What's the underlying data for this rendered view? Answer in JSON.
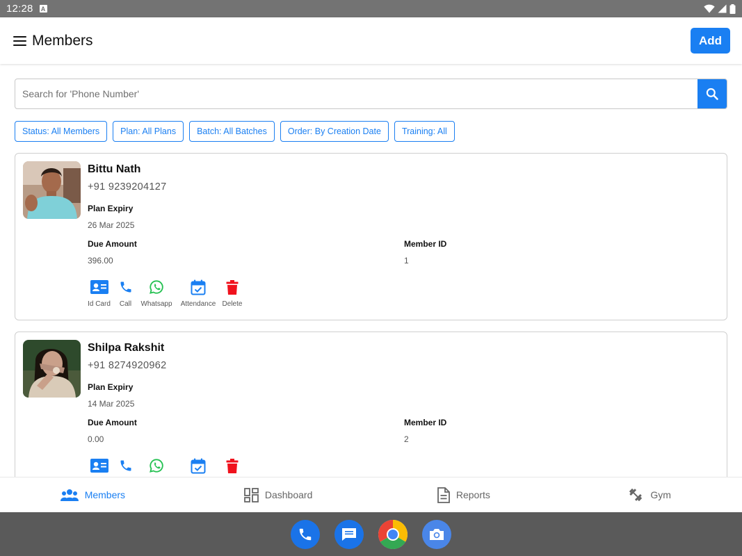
{
  "status_bar": {
    "time": "12:28",
    "notification_glyph": "A"
  },
  "app_bar": {
    "title": "Members",
    "add_label": "Add"
  },
  "search": {
    "placeholder": "Search for 'Phone Number'",
    "value": ""
  },
  "filters": [
    {
      "label": "Status: All Members"
    },
    {
      "label": "Plan: All Plans"
    },
    {
      "label": "Batch: All Batches"
    },
    {
      "label": "Order: By Creation Date"
    },
    {
      "label": "Training: All"
    }
  ],
  "labels": {
    "plan_expiry": "Plan Expiry",
    "due_amount": "Due Amount",
    "member_id": "Member ID"
  },
  "actions": [
    {
      "label": "Id Card",
      "icon": "id-card-icon",
      "color": "#1a7ff2"
    },
    {
      "label": "Call",
      "icon": "phone-icon",
      "color": "#1a7ff2"
    },
    {
      "label": "Whatsapp",
      "icon": "whatsapp-icon",
      "color": "#25c152"
    },
    {
      "label": "Attendance",
      "icon": "calendar-check-icon",
      "color": "#1a7ff2"
    },
    {
      "label": "Delete",
      "icon": "trash-icon",
      "color": "#f0121d"
    }
  ],
  "members": [
    {
      "name": "Bittu Nath",
      "phone": "+91 9239204127",
      "plan_expiry": "26 Mar 2025",
      "due_amount": "396.00",
      "member_id": "1"
    },
    {
      "name": "Shilpa Rakshit",
      "phone": "+91 8274920962",
      "plan_expiry": "14 Mar 2025",
      "due_amount": "0.00",
      "member_id": "2"
    }
  ],
  "bottom_nav": [
    {
      "label": "Members",
      "icon": "members-icon",
      "active": true
    },
    {
      "label": "Dashboard",
      "icon": "dashboard-icon",
      "active": false
    },
    {
      "label": "Reports",
      "icon": "reports-icon",
      "active": false
    },
    {
      "label": "Gym",
      "icon": "dumbbell-icon",
      "active": false
    }
  ],
  "dock": [
    {
      "icon": "phone-app-icon"
    },
    {
      "icon": "messages-app-icon"
    },
    {
      "icon": "chrome-app-icon"
    },
    {
      "icon": "camera-app-icon"
    }
  ],
  "colors": {
    "accent": "#1a7ff2",
    "whatsapp": "#25c152",
    "danger": "#f0121d"
  }
}
